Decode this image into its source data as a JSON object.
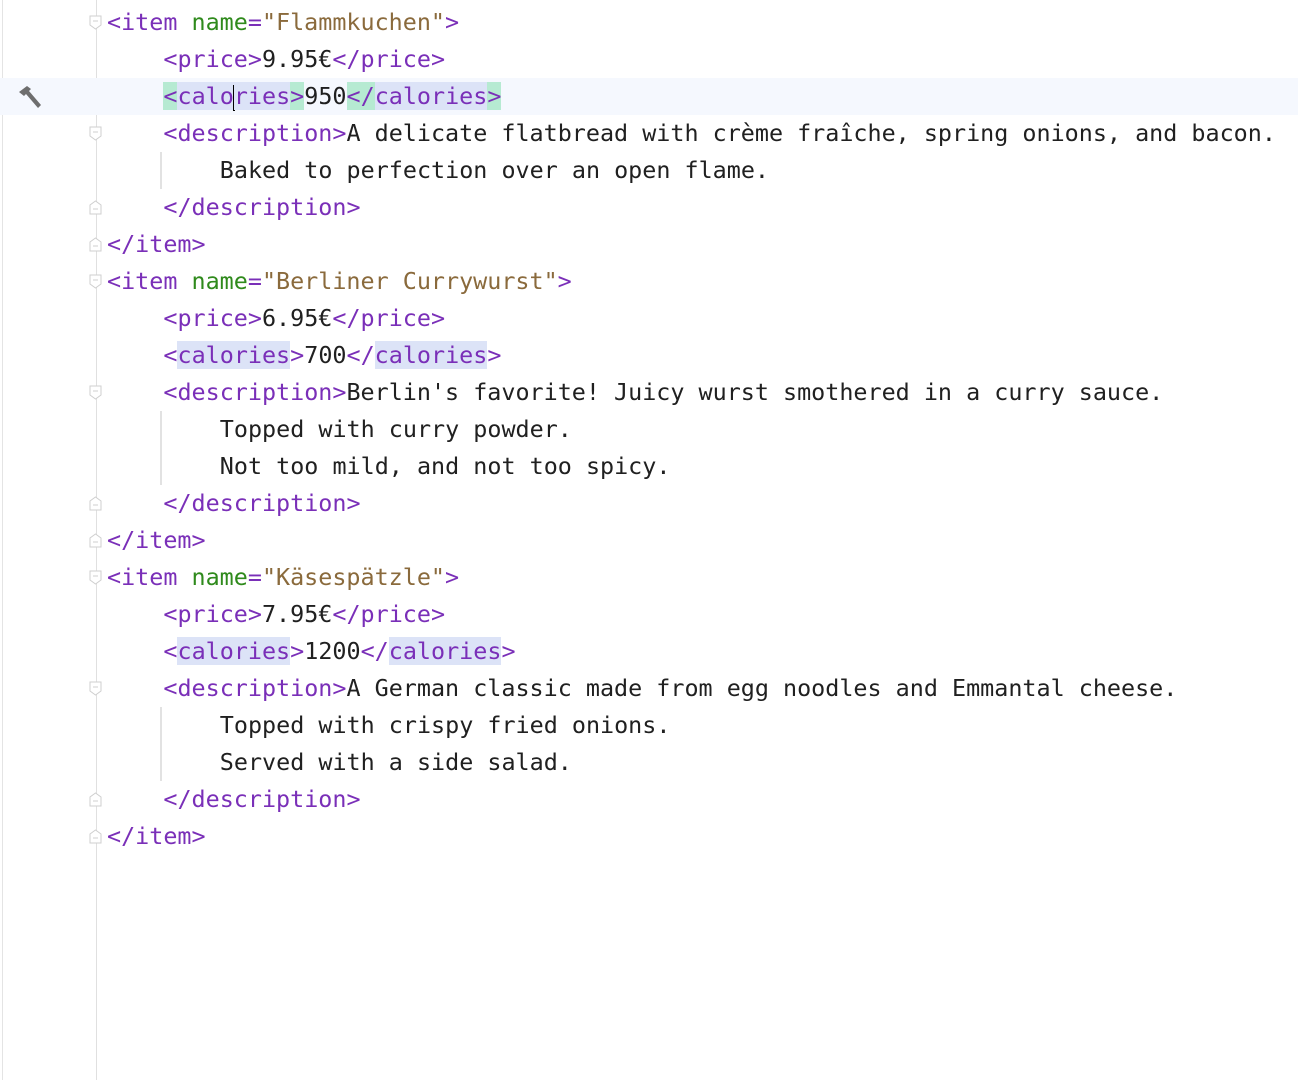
{
  "editor": {
    "current_line": 2,
    "caret_after_token": [
      2,
      1,
      4
    ],
    "colors": {
      "tag": "#7a2fb8",
      "attribute": "#2f8a1c",
      "value": "#8a6a3c",
      "text": "#202020",
      "identifier_highlight": "#dce3f7",
      "brace_highlight": "#b6ead2"
    },
    "gutter_icon": "hammer-icon",
    "lines": [
      {
        "indent": 0,
        "fold": "open",
        "tokens": [
          {
            "t": "tag",
            "s": "<item "
          },
          {
            "t": "attr",
            "s": "name"
          },
          {
            "t": "tag",
            "s": "="
          },
          {
            "t": "val",
            "s": "\"Flammkuchen\""
          },
          {
            "t": "tag",
            "s": ">"
          }
        ]
      },
      {
        "indent": 1,
        "tokens": [
          {
            "t": "tag",
            "s": "<price>"
          },
          {
            "t": "txt",
            "s": "9.95€"
          },
          {
            "t": "tag",
            "s": "</price>"
          }
        ]
      },
      {
        "indent": 1,
        "tokens": [
          {
            "t": "tag hl-brace",
            "s": "<"
          },
          {
            "t": "tag hl-name",
            "s": "calo"
          },
          {
            "t": "tag hl-name",
            "s": "ries"
          },
          {
            "t": "tag hl-brace",
            "s": ">"
          },
          {
            "t": "txt",
            "s": "950"
          },
          {
            "t": "tag hl-brace",
            "s": "</"
          },
          {
            "t": "tag hl-name",
            "s": "calories"
          },
          {
            "t": "tag hl-brace",
            "s": ">"
          }
        ]
      },
      {
        "indent": 1,
        "fold": "open",
        "tokens": [
          {
            "t": "tag",
            "s": "<description>"
          },
          {
            "t": "txt",
            "s": "A delicate flatbread with crème fraîche, spring onions, and bacon."
          }
        ]
      },
      {
        "indent": 2,
        "tokens": [
          {
            "t": "txt",
            "s": "Baked to perfection over an open flame."
          }
        ]
      },
      {
        "indent": 1,
        "fold": "close",
        "tokens": [
          {
            "t": "tag",
            "s": "</description>"
          }
        ]
      },
      {
        "indent": 0,
        "fold": "close",
        "tokens": [
          {
            "t": "tag",
            "s": "</item>"
          }
        ]
      },
      {
        "indent": 0,
        "fold": "open",
        "tokens": [
          {
            "t": "tag",
            "s": "<item "
          },
          {
            "t": "attr",
            "s": "name"
          },
          {
            "t": "tag",
            "s": "="
          },
          {
            "t": "val",
            "s": "\"Berliner Currywurst\""
          },
          {
            "t": "tag",
            "s": ">"
          }
        ]
      },
      {
        "indent": 1,
        "tokens": [
          {
            "t": "tag",
            "s": "<price>"
          },
          {
            "t": "txt",
            "s": "6.95€"
          },
          {
            "t": "tag",
            "s": "</price>"
          }
        ]
      },
      {
        "indent": 1,
        "tokens": [
          {
            "t": "tag",
            "s": "<"
          },
          {
            "t": "tag hl-name",
            "s": "calories"
          },
          {
            "t": "tag",
            "s": ">"
          },
          {
            "t": "txt",
            "s": "700"
          },
          {
            "t": "tag",
            "s": "</"
          },
          {
            "t": "tag hl-name",
            "s": "calories"
          },
          {
            "t": "tag",
            "s": ">"
          }
        ]
      },
      {
        "indent": 1,
        "fold": "open",
        "tokens": [
          {
            "t": "tag",
            "s": "<description>"
          },
          {
            "t": "txt",
            "s": "Berlin's favorite! Juicy wurst smothered in a curry sauce."
          }
        ]
      },
      {
        "indent": 2,
        "tokens": [
          {
            "t": "txt",
            "s": "Topped with curry powder."
          }
        ]
      },
      {
        "indent": 2,
        "tokens": [
          {
            "t": "txt",
            "s": "Not too mild, and not too spicy."
          }
        ]
      },
      {
        "indent": 1,
        "fold": "close",
        "tokens": [
          {
            "t": "tag",
            "s": "</description>"
          }
        ]
      },
      {
        "indent": 0,
        "fold": "close",
        "tokens": [
          {
            "t": "tag",
            "s": "</item>"
          }
        ]
      },
      {
        "indent": 0,
        "fold": "open",
        "tokens": [
          {
            "t": "tag",
            "s": "<item "
          },
          {
            "t": "attr",
            "s": "name"
          },
          {
            "t": "tag",
            "s": "="
          },
          {
            "t": "val",
            "s": "\"Käsespätzle\""
          },
          {
            "t": "tag",
            "s": ">"
          }
        ]
      },
      {
        "indent": 1,
        "tokens": [
          {
            "t": "tag",
            "s": "<price>"
          },
          {
            "t": "txt",
            "s": "7.95€"
          },
          {
            "t": "tag",
            "s": "</price>"
          }
        ]
      },
      {
        "indent": 1,
        "tokens": [
          {
            "t": "tag",
            "s": "<"
          },
          {
            "t": "tag hl-name",
            "s": "calories"
          },
          {
            "t": "tag",
            "s": ">"
          },
          {
            "t": "txt",
            "s": "1200"
          },
          {
            "t": "tag",
            "s": "</"
          },
          {
            "t": "tag hl-name",
            "s": "calories"
          },
          {
            "t": "tag",
            "s": ">"
          }
        ]
      },
      {
        "indent": 1,
        "fold": "open",
        "tokens": [
          {
            "t": "tag",
            "s": "<description>"
          },
          {
            "t": "txt",
            "s": "A German classic made from egg noodles and Emmantal cheese."
          }
        ]
      },
      {
        "indent": 2,
        "tokens": [
          {
            "t": "txt",
            "s": "Topped with crispy fried onions."
          }
        ]
      },
      {
        "indent": 2,
        "tokens": [
          {
            "t": "txt",
            "s": "Served with a side salad."
          }
        ]
      },
      {
        "indent": 1,
        "fold": "close",
        "tokens": [
          {
            "t": "tag",
            "s": "</description>"
          }
        ]
      },
      {
        "indent": 0,
        "fold": "close",
        "tokens": [
          {
            "t": "tag",
            "s": "</item>"
          }
        ]
      }
    ]
  }
}
